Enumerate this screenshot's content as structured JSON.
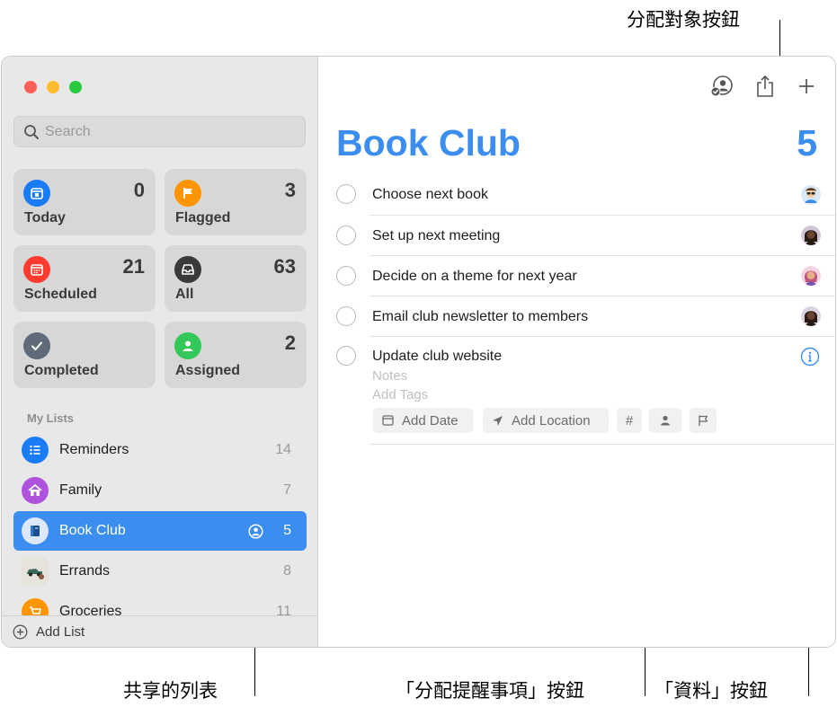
{
  "callouts": {
    "assign_button": "分配對象按鈕",
    "shared_list": "共享的列表",
    "assign_reminder_button": "「分配提醒事項」按鈕",
    "info_button": "「資料」按鈕"
  },
  "search": {
    "placeholder": "Search"
  },
  "smart_lists": [
    {
      "label": "Today",
      "count": "0",
      "color": "#1a7cf5",
      "icon": "calendar-icon"
    },
    {
      "label": "Flagged",
      "count": "3",
      "color": "#ff9500",
      "icon": "flag-icon"
    },
    {
      "label": "Scheduled",
      "count": "21",
      "color": "#ff3b30",
      "icon": "calendar-grid-icon"
    },
    {
      "label": "All",
      "count": "63",
      "color": "#3a3a3c",
      "icon": "tray-icon"
    },
    {
      "label": "Completed",
      "count": "",
      "color": "#5f6b78",
      "icon": "checkmark-icon"
    },
    {
      "label": "Assigned",
      "count": "2",
      "color": "#34c759",
      "icon": "person-icon"
    }
  ],
  "my_lists_header": "My Lists",
  "my_lists": [
    {
      "name": "Reminders",
      "count": "14",
      "color": "#1a7cf5",
      "icon": "list-icon"
    },
    {
      "name": "Family",
      "count": "7",
      "color": "#af52de",
      "icon": "house-icon"
    },
    {
      "name": "Book Club",
      "count": "5",
      "color": "#3b8ef0",
      "icon": "book-icon",
      "selected": true,
      "shared": true
    },
    {
      "name": "Errands",
      "count": "8",
      "color": "#e6e2dc",
      "icon": "car-icon"
    },
    {
      "name": "Groceries",
      "count": "11",
      "color": "#ff9500",
      "icon": "cart-icon"
    }
  ],
  "add_list_label": "Add List",
  "main": {
    "title": "Book Club",
    "total": "5",
    "todos": [
      {
        "title": "Choose next book",
        "avatar_color": "#5aa9e6"
      },
      {
        "title": "Set up next meeting",
        "avatar_color": "#3b2a2a"
      },
      {
        "title": "Decide on a theme for next year",
        "avatar_color": "#e88ab0"
      },
      {
        "title": "Email club newsletter to members",
        "avatar_color": "#3b2a2a"
      },
      {
        "title": "Update club website",
        "avatar_color": ""
      }
    ],
    "editing": {
      "notes_placeholder": "Notes",
      "tags_placeholder": "Add Tags",
      "add_date": "Add Date",
      "add_location": "Add Location",
      "tag_symbol": "#"
    }
  }
}
